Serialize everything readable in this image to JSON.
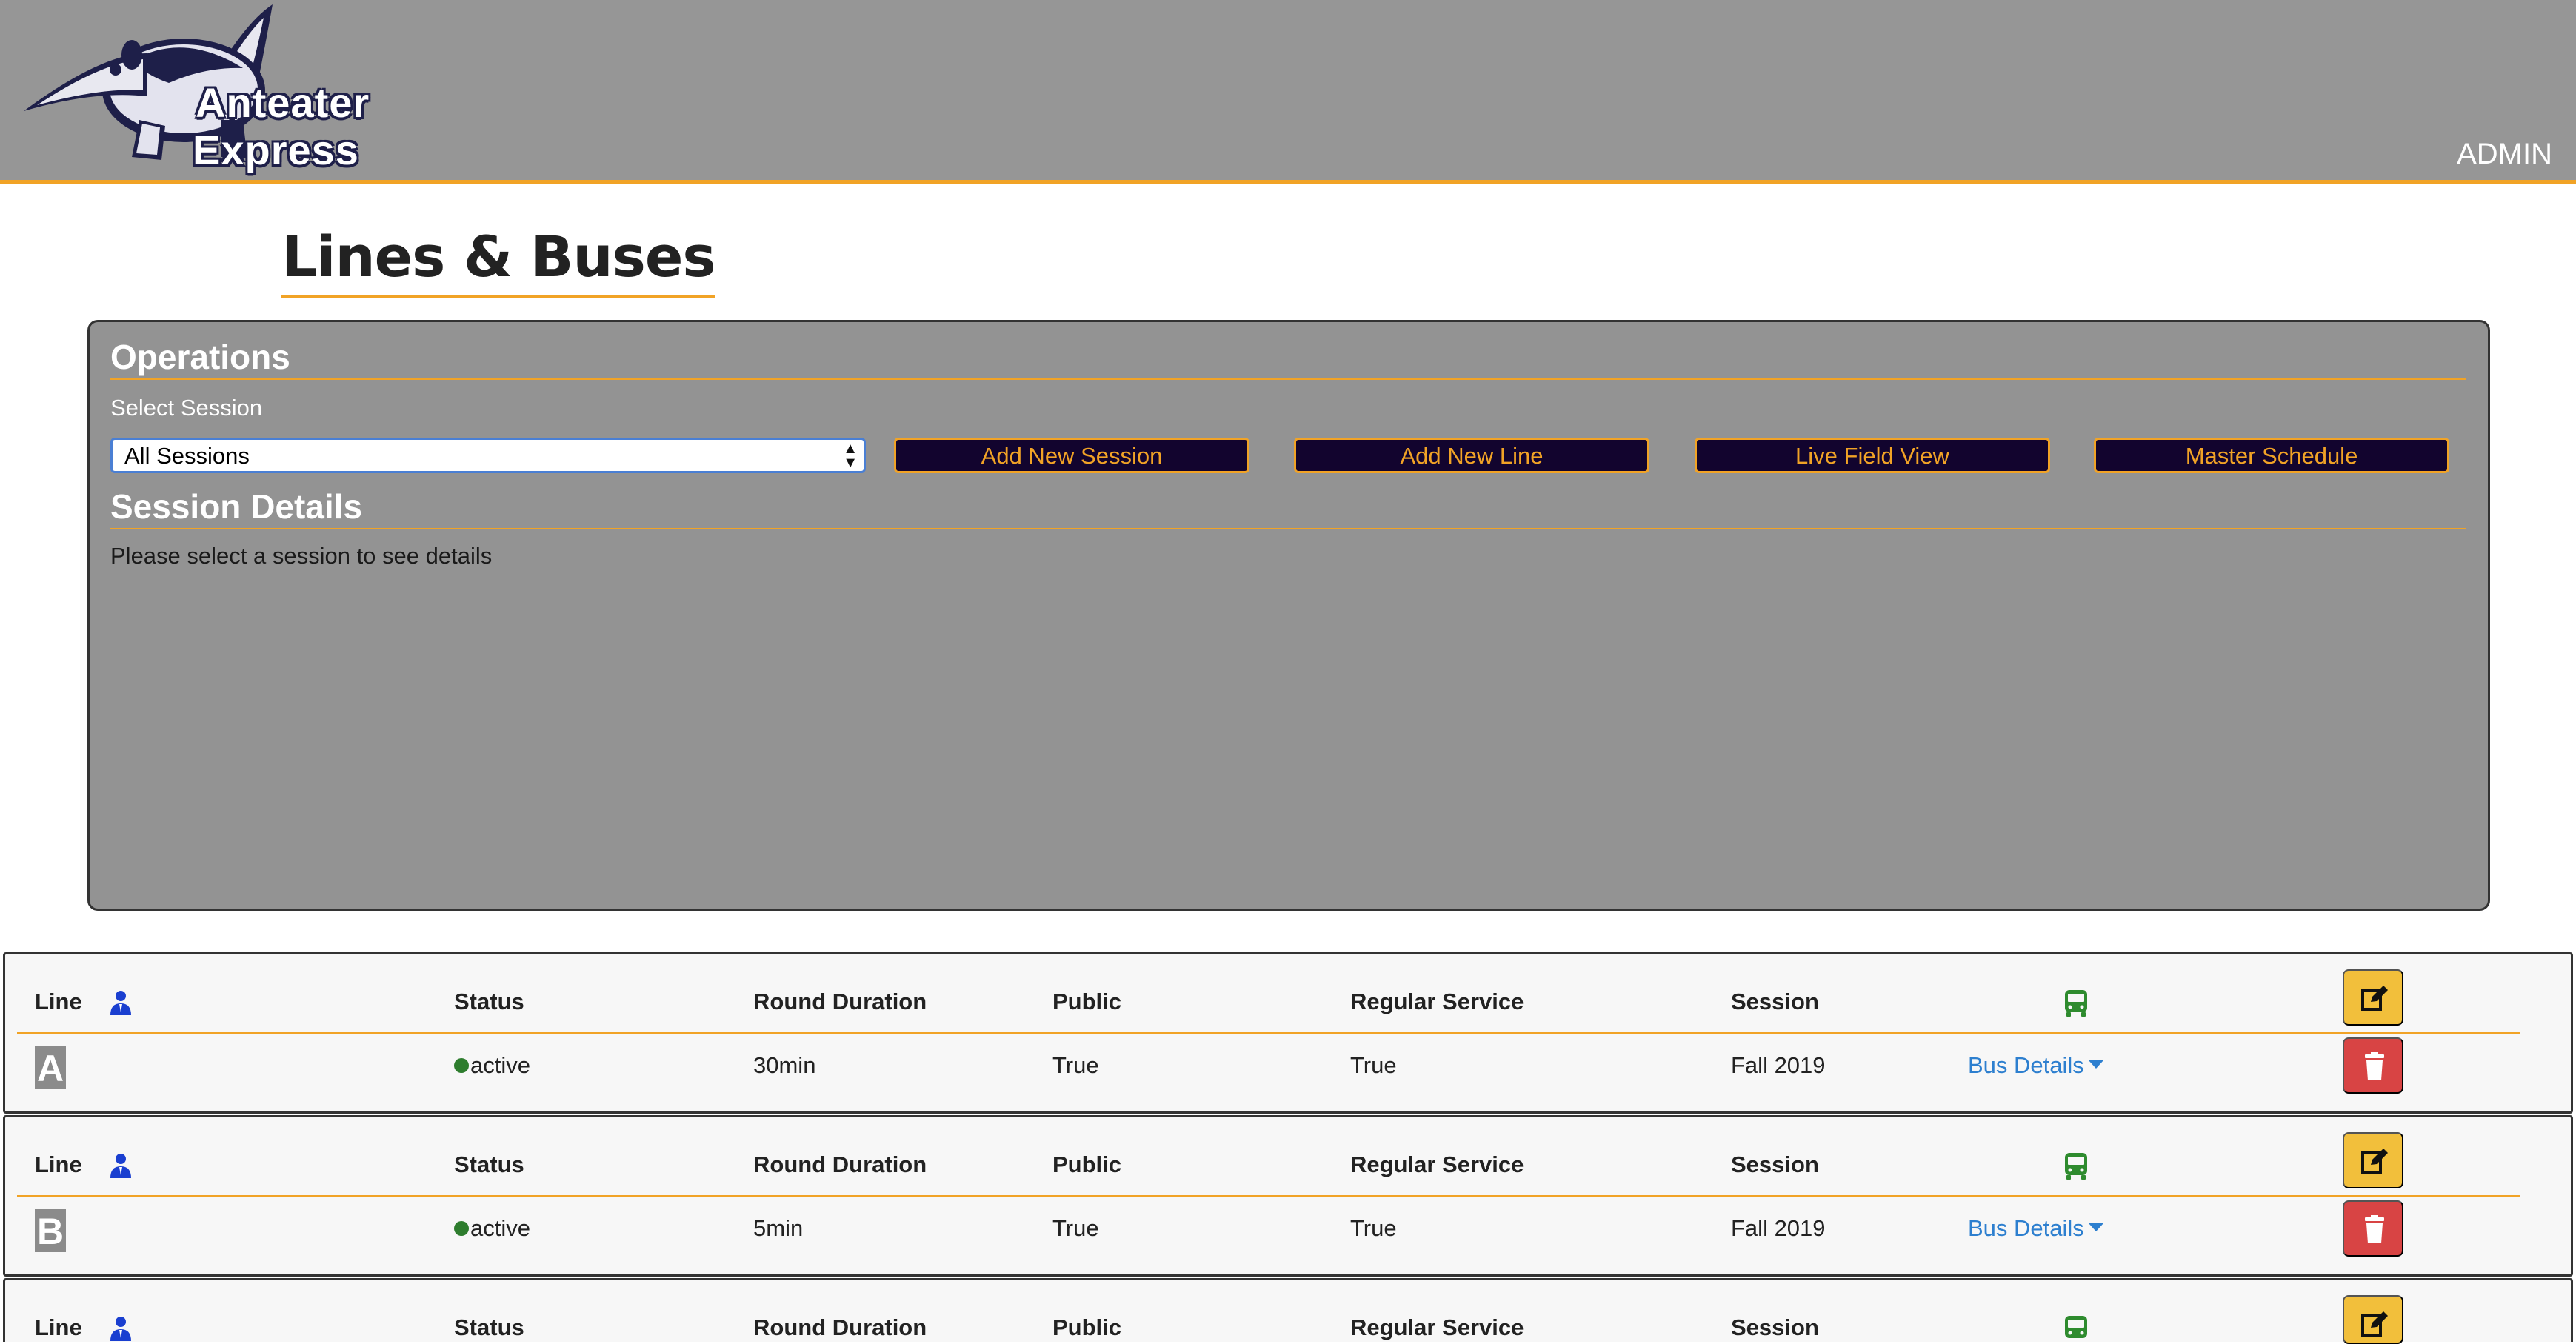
{
  "header": {
    "logo_line1": "Anteater",
    "logo_line2": "Express",
    "admin_label": "ADMIN"
  },
  "page": {
    "title": "Lines & Buses"
  },
  "operations": {
    "title": "Operations",
    "select_label": "Select Session",
    "select_value": "All Sessions",
    "buttons": {
      "add_session": "Add New Session",
      "add_line": "Add New Line",
      "live_view": "Live Field View",
      "master_schedule": "Master Schedule"
    },
    "details_title": "Session Details",
    "details_text": "Please select a session to see details"
  },
  "table_headers": {
    "line": "Line",
    "status": "Status",
    "round_duration": "Round Duration",
    "public": "Public",
    "regular_service": "Regular Service",
    "session": "Session"
  },
  "lines": [
    {
      "letter": "A",
      "status": "active",
      "round_duration": "30min",
      "public": "True",
      "regular_service": "True",
      "session": "Fall 2019",
      "bus_details": "Bus Details"
    },
    {
      "letter": "B",
      "status": "active",
      "round_duration": "5min",
      "public": "True",
      "regular_service": "True",
      "session": "Fall 2019",
      "bus_details": "Bus Details"
    }
  ],
  "colors": {
    "accent": "#f1a326",
    "header_bg": "#969696",
    "button_bg": "#12042e",
    "active_status": "#2e7d2e",
    "link": "#2d7fcf",
    "edit": "#f2bf3b",
    "delete": "#d84444"
  },
  "icons": {
    "line_header": "user-icon",
    "bus_header": "bus-icon",
    "edit": "edit-icon",
    "delete": "trash-icon"
  }
}
